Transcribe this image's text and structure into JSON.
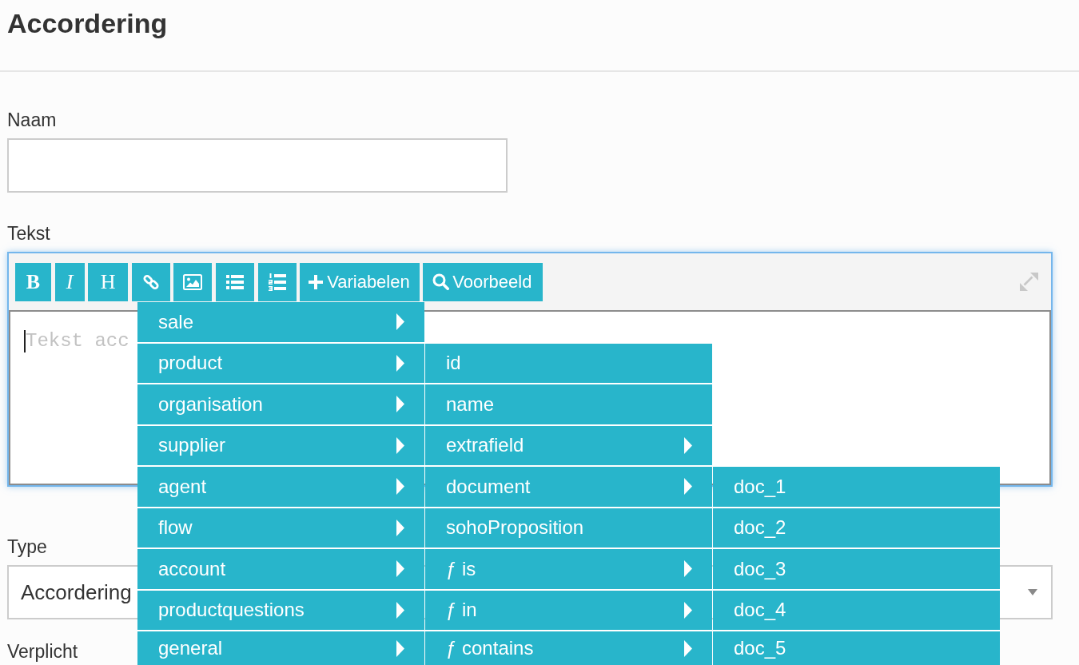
{
  "header": {
    "title": "Accordering"
  },
  "fields": [
    {
      "kind": "input",
      "label": "Naam"
    },
    {
      "kind": "editor",
      "label": "Tekst",
      "focused": true,
      "placeholder": "Tekst acc",
      "toolbar": [
        {
          "kind": "bold",
          "label": "B"
        },
        {
          "kind": "italic",
          "label": "I"
        },
        {
          "kind": "heading",
          "label": "H"
        },
        {
          "kind": "link"
        },
        {
          "kind": "image"
        },
        {
          "kind": "bullets"
        },
        {
          "kind": "numbers"
        },
        {
          "kind": "variables",
          "label": "Variabelen"
        },
        {
          "kind": "preview",
          "label": "Voorbeeld"
        }
      ]
    },
    {
      "kind": "select",
      "label": "Type",
      "value": "Accordering"
    },
    {
      "kind": "label",
      "label": "Verplicht"
    }
  ],
  "variables_menu": {
    "items": [
      {
        "label": "sale",
        "has_submenu": true
      },
      {
        "label": "product",
        "has_submenu": true,
        "children": [
          {
            "label": "id",
            "has_submenu": false
          },
          {
            "label": "name",
            "has_submenu": false
          },
          {
            "label": "extrafield",
            "has_submenu": true
          },
          {
            "label": "document",
            "has_submenu": true,
            "children": [
              {
                "label": "doc_1",
                "has_submenu": false
              },
              {
                "label": "doc_2",
                "has_submenu": false
              },
              {
                "label": "doc_3",
                "has_submenu": false
              },
              {
                "label": "doc_4",
                "has_submenu": false
              },
              {
                "label": "doc_5",
                "has_submenu": false
              }
            ]
          },
          {
            "label": "sohoProposition",
            "has_submenu": false
          },
          {
            "label": "ƒ is",
            "has_submenu": true
          },
          {
            "label": "ƒ in",
            "has_submenu": true
          },
          {
            "label": "ƒ contains",
            "has_submenu": true
          }
        ]
      },
      {
        "label": "organisation",
        "has_submenu": true
      },
      {
        "label": "supplier",
        "has_submenu": true
      },
      {
        "label": "agent",
        "has_submenu": true
      },
      {
        "label": "flow",
        "has_submenu": true
      },
      {
        "label": "account",
        "has_submenu": true
      },
      {
        "label": "productquestions",
        "has_submenu": true
      },
      {
        "label": "general",
        "has_submenu": true
      }
    ]
  }
}
